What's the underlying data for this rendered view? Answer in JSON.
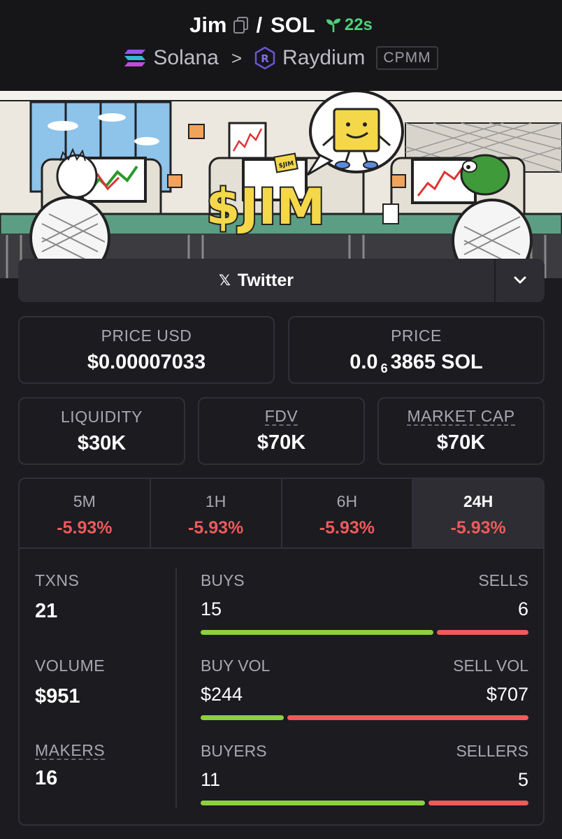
{
  "header": {
    "token": "Jim",
    "slash": "/",
    "quote": "SOL",
    "age": "22s",
    "chain": "Solana",
    "separator": ">",
    "dex": "Raydium",
    "pool_type": "CPMM"
  },
  "banner": {
    "ticker": "$JIM",
    "sign_text": "$JIM"
  },
  "social": {
    "twitter_label": "Twitter",
    "x_glyph": "𝕏"
  },
  "price": {
    "usd_label": "PRICE USD",
    "usd_value": "$0.00007033",
    "native_label": "PRICE",
    "native_prefix": "0.0",
    "native_zeros": "6",
    "native_suffix": "3865 SOL"
  },
  "metrics": {
    "liquidity_label": "LIQUIDITY",
    "liquidity_value": "$30K",
    "fdv_label": "FDV",
    "fdv_value": "$70K",
    "mcap_label": "MARKET CAP",
    "mcap_value": "$70K"
  },
  "timeframes": [
    {
      "label": "5M",
      "change": "-5.93%"
    },
    {
      "label": "1H",
      "change": "-5.93%"
    },
    {
      "label": "6H",
      "change": "-5.93%"
    },
    {
      "label": "24H",
      "change": "-5.93%"
    }
  ],
  "stats": {
    "txns_label": "TXNS",
    "txns_value": "21",
    "volume_label": "VOLUME",
    "volume_value": "$951",
    "makers_label": "MAKERS",
    "makers_value": "16",
    "buys_label": "BUYS",
    "buys_value": "15",
    "sells_label": "SELLS",
    "sells_value": "6",
    "buy_vol_label": "BUY VOL",
    "buy_vol_value": "$244",
    "sell_vol_label": "SELL VOL",
    "sell_vol_value": "$707",
    "buyers_label": "BUYERS",
    "buyers_value": "11",
    "sellers_label": "SELLERS",
    "sellers_value": "5"
  },
  "ratios": {
    "buys_share": 0.714,
    "buy_vol_share": 0.257,
    "buyers_share": 0.688
  },
  "colors": {
    "positive": "#8cd040",
    "negative": "#ef5a5a",
    "age": "#4ed07a",
    "background": "#1b1b20"
  }
}
